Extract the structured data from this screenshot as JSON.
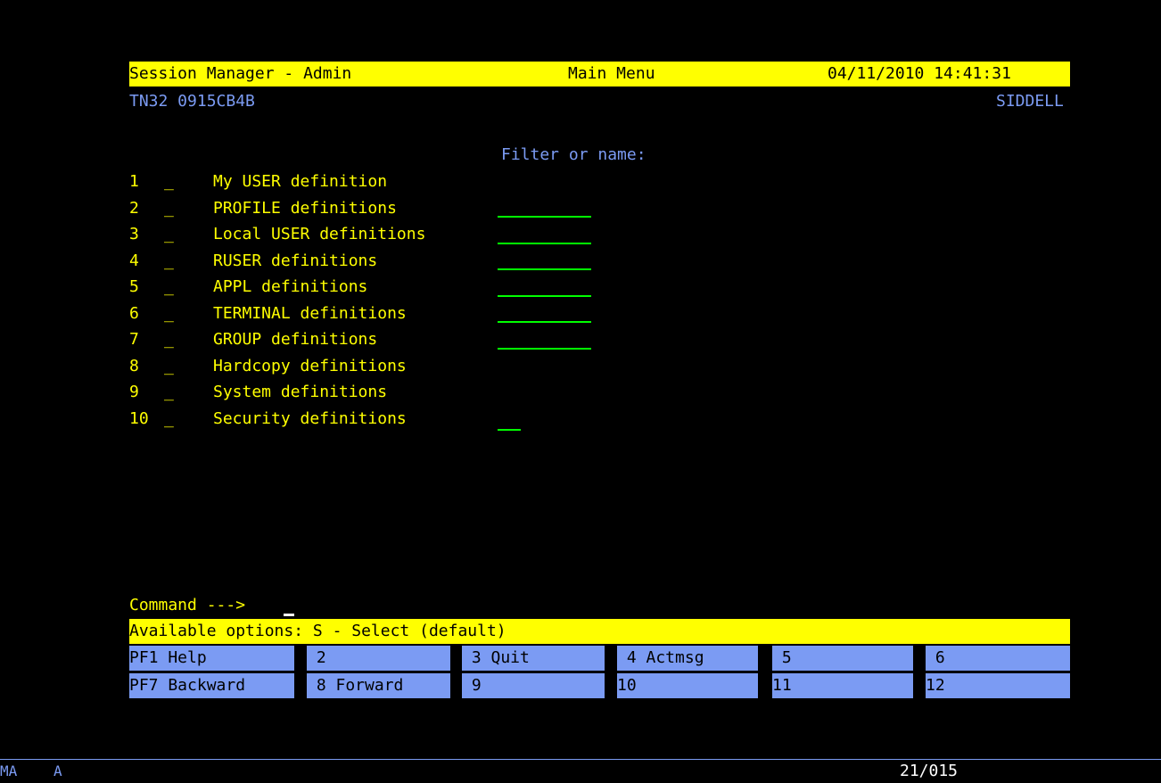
{
  "header": {
    "left": "Session Manager - Admin",
    "center": "Main Menu",
    "right": "04/11/2010 14:41:31"
  },
  "subheader": {
    "terminal": "TN32 0915CB4B",
    "user": "SIDDELL"
  },
  "filter_label": "Filter or name:",
  "menu": {
    "items": [
      {
        "num": "1",
        "sel": "_",
        "label": "My USER definition"
      },
      {
        "num": "2",
        "sel": "_",
        "label": "PROFILE definitions"
      },
      {
        "num": "3",
        "sel": "_",
        "label": "Local USER definitions"
      },
      {
        "num": "4",
        "sel": "_",
        "label": "RUSER definitions"
      },
      {
        "num": "5",
        "sel": "_",
        "label": "APPL definitions"
      },
      {
        "num": "6",
        "sel": "_",
        "label": "TERMINAL definitions"
      },
      {
        "num": "7",
        "sel": "_",
        "label": "GROUP definitions"
      },
      {
        "num": "8",
        "sel": "_",
        "label": "Hardcopy definitions"
      },
      {
        "num": "9",
        "sel": "_",
        "label": "System definitions"
      },
      {
        "num": "10",
        "sel": "_",
        "label": "Security definitions"
      }
    ]
  },
  "command": {
    "label": "Command --->",
    "value": ""
  },
  "options_line": "Available options: S - Select (default)",
  "pfkeys": {
    "row1": [
      "PF1 Help",
      " 2",
      " 3 Quit",
      " 4 Actmsg",
      " 5",
      " 6"
    ],
    "row2": [
      "PF7 Backward",
      " 8 Forward",
      " 9",
      "10",
      "11",
      "12"
    ]
  },
  "status": {
    "mode": "MA",
    "indicator": "A",
    "cursor_pos": "21/015"
  },
  "colors": {
    "background": "#000000",
    "yellow": "#ffff00",
    "blue": "#7b9bf3",
    "green": "#00ff00"
  }
}
